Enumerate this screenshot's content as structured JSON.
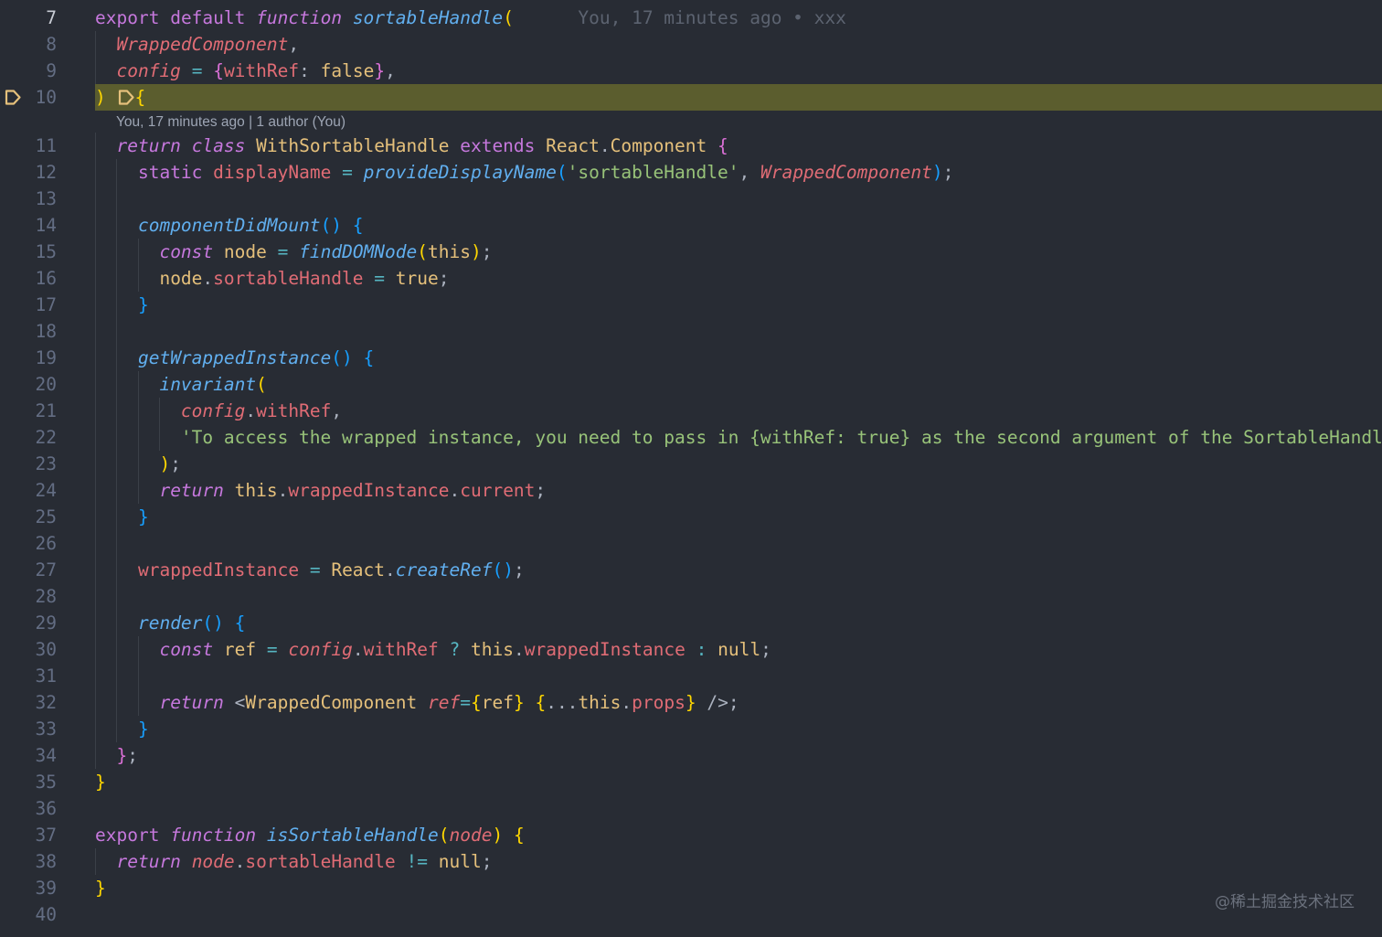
{
  "editor": {
    "watermark": "@稀土掘金技术社区",
    "codelens": "You, 17 minutes ago | 1 author (You)",
    "blame_inline": "You, 17 minutes ago • xxx",
    "colors": {
      "background": "#282c34",
      "breakpoint_band": "#5b5d2e",
      "breakpoint_icon": "#e5c07b",
      "keyword": "#c678dd",
      "function": "#61afef",
      "variable": "#e06c75",
      "string": "#98c379",
      "class": "#e5c07b"
    },
    "lines": [
      {
        "number": "7",
        "text": "export default function sortableHandle("
      },
      {
        "number": "8",
        "text": "  WrappedComponent,"
      },
      {
        "number": "9",
        "text": "  config = {withRef: false},"
      },
      {
        "number": "10",
        "text": ") {"
      },
      {
        "number": "11",
        "text": "  return class WithSortableHandle extends React.Component {"
      },
      {
        "number": "12",
        "text": "    static displayName = provideDisplayName('sortableHandle', WrappedComponent);"
      },
      {
        "number": "13",
        "text": ""
      },
      {
        "number": "14",
        "text": "    componentDidMount() {"
      },
      {
        "number": "15",
        "text": "      const node = findDOMNode(this);"
      },
      {
        "number": "16",
        "text": "      node.sortableHandle = true;"
      },
      {
        "number": "17",
        "text": "    }"
      },
      {
        "number": "18",
        "text": ""
      },
      {
        "number": "19",
        "text": "    getWrappedInstance() {"
      },
      {
        "number": "20",
        "text": "      invariant("
      },
      {
        "number": "21",
        "text": "        config.withRef,"
      },
      {
        "number": "22",
        "text": "        'To access the wrapped instance, you need to pass in {withRef: true} as the second argument of the SortableHandle"
      },
      {
        "number": "23",
        "text": "      );"
      },
      {
        "number": "24",
        "text": "      return this.wrappedInstance.current;"
      },
      {
        "number": "25",
        "text": "    }"
      },
      {
        "number": "26",
        "text": ""
      },
      {
        "number": "27",
        "text": "    wrappedInstance = React.createRef();"
      },
      {
        "number": "28",
        "text": ""
      },
      {
        "number": "29",
        "text": "    render() {"
      },
      {
        "number": "30",
        "text": "      const ref = config.withRef ? this.wrappedInstance : null;"
      },
      {
        "number": "31",
        "text": ""
      },
      {
        "number": "32",
        "text": "      return <WrappedComponent ref={ref} {...this.props} />;"
      },
      {
        "number": "33",
        "text": "    }"
      },
      {
        "number": "34",
        "text": "  };"
      },
      {
        "number": "35",
        "text": "}"
      },
      {
        "number": "36",
        "text": ""
      },
      {
        "number": "37",
        "text": "export function isSortableHandle(node) {"
      },
      {
        "number": "38",
        "text": "  return node.sortableHandle != null;"
      },
      {
        "number": "39",
        "text": "}"
      },
      {
        "number": "40",
        "text": ""
      }
    ]
  }
}
